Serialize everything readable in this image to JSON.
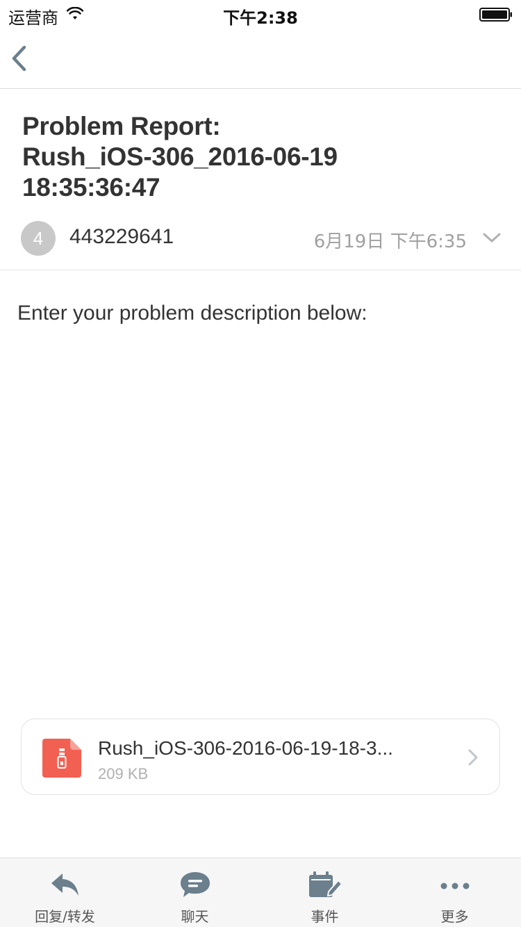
{
  "status_bar": {
    "carrier": "运营商",
    "time": "下午2:38"
  },
  "email": {
    "subject_lines": [
      "Problem Report:",
      "Rush_iOS-306_2016-06-19",
      "18:35:36:47"
    ],
    "sender": {
      "avatar_initial": "4",
      "name": "443229641"
    },
    "date": "6月19日 下午6:35",
    "body": "Enter your problem description below:",
    "attachment": {
      "name": "Rush_iOS-306-2016-06-19-18-3...",
      "size": "209 KB",
      "icon": "zip-file-icon",
      "icon_color": "#f26052"
    }
  },
  "toolbar": {
    "items": [
      {
        "label": "回复/转发",
        "icon": "reply-icon"
      },
      {
        "label": "聊天",
        "icon": "chat-bubble-icon"
      },
      {
        "label": "事件",
        "icon": "calendar-edit-icon"
      },
      {
        "label": "更多",
        "icon": "more-dots-icon"
      }
    ]
  },
  "colors": {
    "accent_gray_blue": "#6b7f8c",
    "muted_text": "#a0a0a0",
    "attachment_red": "#f26052"
  }
}
